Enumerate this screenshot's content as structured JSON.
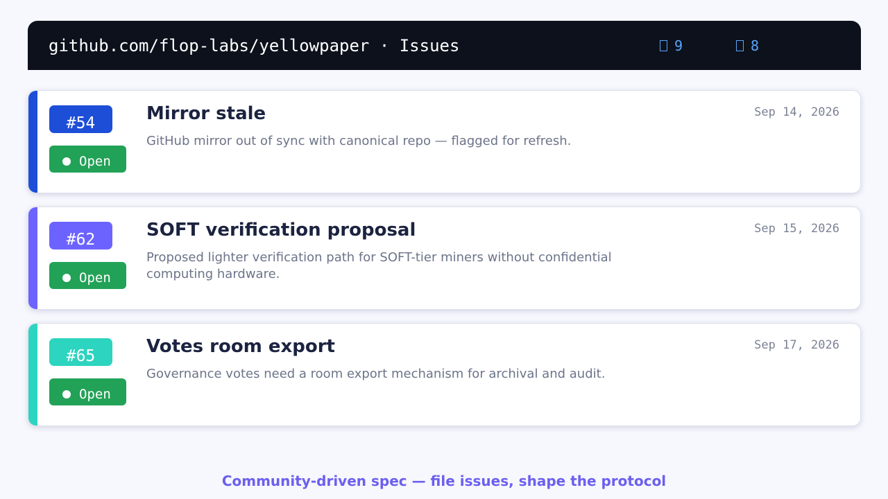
{
  "header": {
    "title": "github.com/flop-labs/yellowpaper · Issues",
    "open_count": "9",
    "comment_count": "8",
    "open_icon": "issue-icon",
    "comment_icon": "comment-icon",
    "background": "#0c111b",
    "stat_color": "#58a6ff"
  },
  "issues": [
    {
      "number": "#54",
      "title": "Mirror stale",
      "description": "GitHub mirror out of sync with canonical repo — flagged for refresh.",
      "state": "Open",
      "date": "Sep 14, 2026",
      "accent": "#1d4ed8"
    },
    {
      "number": "#62",
      "title": "SOFT verification proposal",
      "description": "Proposed lighter verification path for SOFT-tier miners without confidential computing hardware.",
      "state": "Open",
      "date": "Sep 15, 2026",
      "accent": "#6c63ff"
    },
    {
      "number": "#65",
      "title": "Votes room export",
      "description": "Governance votes need a room export mechanism for archival and audit.",
      "state": "Open",
      "date": "Sep 17, 2026",
      "accent": "#2dd4bf"
    }
  ],
  "state_color": "#22a257",
  "footer": {
    "text": "Community-driven spec — file issues, shape the protocol",
    "color": "#6c5fef"
  }
}
